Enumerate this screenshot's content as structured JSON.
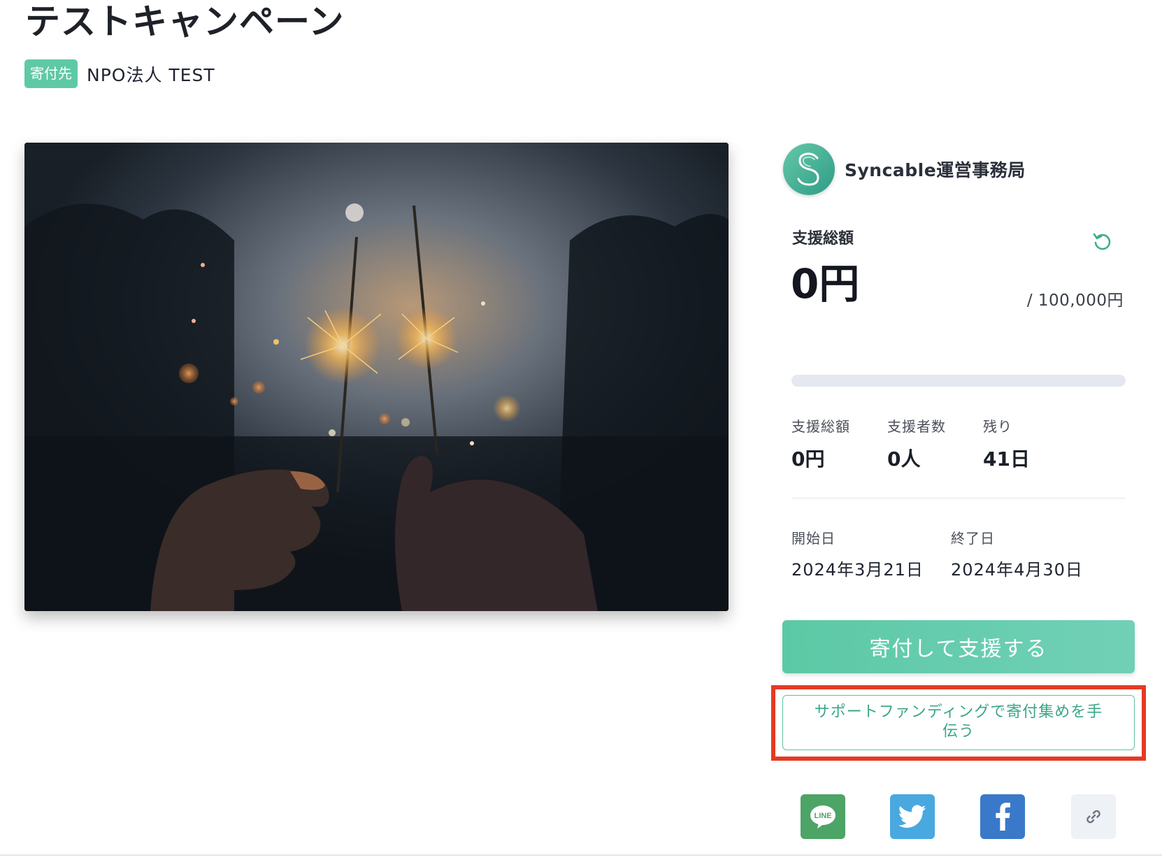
{
  "campaign": {
    "title": "テストキャンペーン",
    "beneficiary_tag": "寄付先",
    "beneficiary_name": "NPO法人 TEST"
  },
  "organizer": {
    "name": "Syncable運営事務局",
    "avatar_letter": "S"
  },
  "funding": {
    "total_label": "支援総額",
    "amount": "0円",
    "goal": "/ 100,000円",
    "progress_fraction": 0
  },
  "stats": [
    {
      "label": "支援総額",
      "value": "0円"
    },
    {
      "label": "支援者数",
      "value": "0人"
    },
    {
      "label": "残り",
      "value": "41日"
    }
  ],
  "dates": {
    "start_label": "開始日",
    "start_value": "2024年3月21日",
    "end_label": "終了日",
    "end_value": "2024年4月30日"
  },
  "actions": {
    "donate_label": "寄付して支援する",
    "support_funding_label": "サポートファンディングで寄付集めを手伝う"
  },
  "share": {
    "line_label": "LINE",
    "icons": [
      "line-icon",
      "twitter-icon",
      "facebook-icon",
      "link-icon"
    ]
  },
  "colors": {
    "accent": "#5fc9a5",
    "highlight": "#e53a24",
    "line": "#4da467",
    "twitter": "#48a8df",
    "facebook": "#3a79c9"
  }
}
